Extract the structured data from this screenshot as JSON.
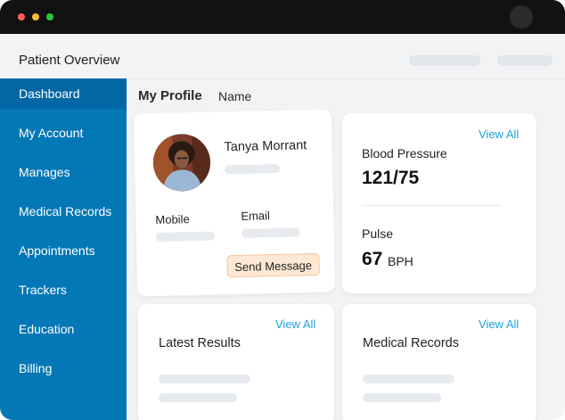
{
  "window": {
    "title": "Patient Overview"
  },
  "sidebar": {
    "items": [
      {
        "label": "Dashboard",
        "active": true
      },
      {
        "label": "My Account"
      },
      {
        "label": "Manages"
      },
      {
        "label": "Medical Records"
      },
      {
        "label": "Appointments"
      },
      {
        "label": "Trackers"
      },
      {
        "label": "Education"
      },
      {
        "label": "Billing"
      }
    ]
  },
  "main": {
    "section_title": "My Profile",
    "section_subtitle": "Name",
    "profile": {
      "name": "Tanya Morrant",
      "mobile_label": "Mobile",
      "email_label": "Email",
      "send_message": "Send Message"
    },
    "vitals": {
      "view_all": "View All",
      "bp_label": "Blood Pressure",
      "bp_value": "121/75",
      "pulse_label": "Pulse",
      "pulse_value": "67",
      "pulse_unit": "BPH"
    },
    "latest_results": {
      "title": "Latest Results",
      "view_all": "View All"
    },
    "medical_records": {
      "title": "Medical Records",
      "view_all": "View All"
    }
  },
  "colors": {
    "sidebar": "#0477b6",
    "sidebar_active": "#0367a5",
    "link": "#1ea0e0",
    "button_bg": "#fde8d3",
    "button_border": "#f3c79c"
  }
}
